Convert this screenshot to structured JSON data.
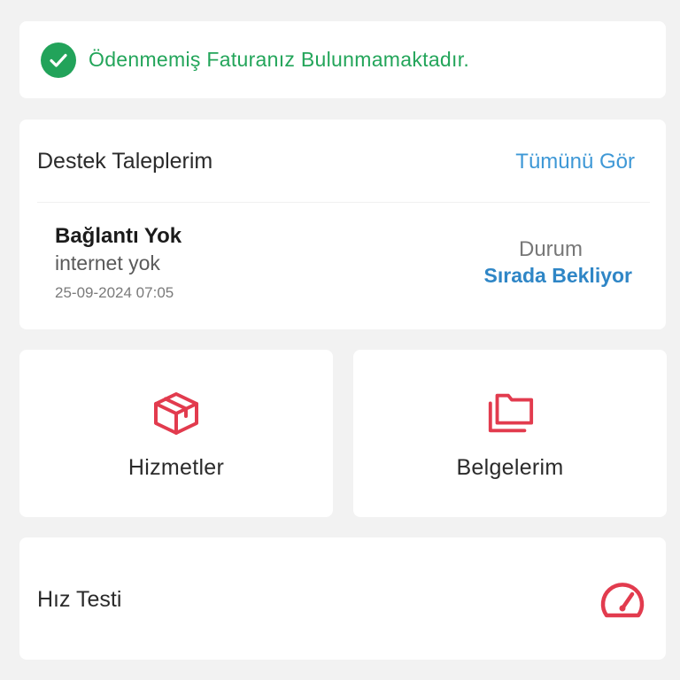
{
  "banner": {
    "text": "Ödenmemiş Faturanız Bulunmamaktadır.",
    "icon": "check-circle-icon",
    "color": "#23a55a"
  },
  "support": {
    "title": "Destek Taleplerim",
    "see_all": "Tümünü Gör",
    "ticket": {
      "title": "Bağlantı Yok",
      "description": "internet yok",
      "date": "25-09-2024 07:05",
      "status_label": "Durum",
      "status_value": "Sırada Bekliyor"
    }
  },
  "tiles": [
    {
      "label": "Hizmetler",
      "icon": "package-icon"
    },
    {
      "label": "Belgelerim",
      "icon": "folders-icon"
    }
  ],
  "speed_test": {
    "label": "Hız Testi",
    "icon": "speedometer-icon"
  },
  "colors": {
    "accent_red": "#e23b4e",
    "link_blue": "#3e98d6",
    "status_blue": "#2f86c6",
    "success_green": "#23a55a",
    "background": "#f2f2f2"
  }
}
